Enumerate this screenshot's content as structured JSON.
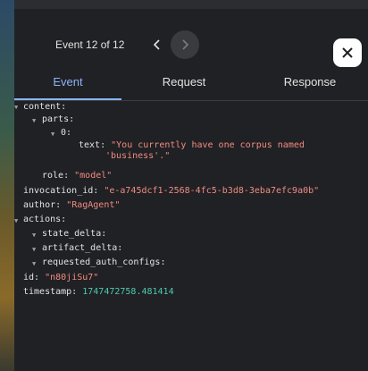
{
  "nav": {
    "event_counter": "Event 12 of 12",
    "prev_icon": "chevron-left-icon",
    "next_icon": "chevron-right-icon",
    "close_icon": "close-icon"
  },
  "tabs": [
    {
      "label": "Event",
      "active": true
    },
    {
      "label": "Request",
      "active": false
    },
    {
      "label": "Response",
      "active": false
    }
  ],
  "colors": {
    "accent": "#8ab4f8",
    "string": "#f28b82",
    "number": "#4ec9b0",
    "panel": "#202124"
  },
  "event": {
    "content_key": "content:",
    "parts_key": "parts:",
    "index0_key": "0:",
    "text_key": "text:",
    "text_value_line1": "\"You currently have one corpus named",
    "text_value_line2": "'business'.\"",
    "role_key": "role:",
    "role_value": "\"model\"",
    "invocation_id_key": "invocation_id:",
    "invocation_id_value": "\"e-a745dcf1-2568-4fc5-b3d8-3eba7efc9a0b\"",
    "author_key": "author:",
    "author_value": "\"RagAgent\"",
    "actions_key": "actions:",
    "state_delta_key": "state_delta:",
    "artifact_delta_key": "artifact_delta:",
    "requested_auth_configs_key": "requested_auth_configs:",
    "id_key": "id:",
    "id_value": "\"n80jiSu7\"",
    "timestamp_key": "timestamp:",
    "timestamp_value": "1747472758.481414"
  }
}
